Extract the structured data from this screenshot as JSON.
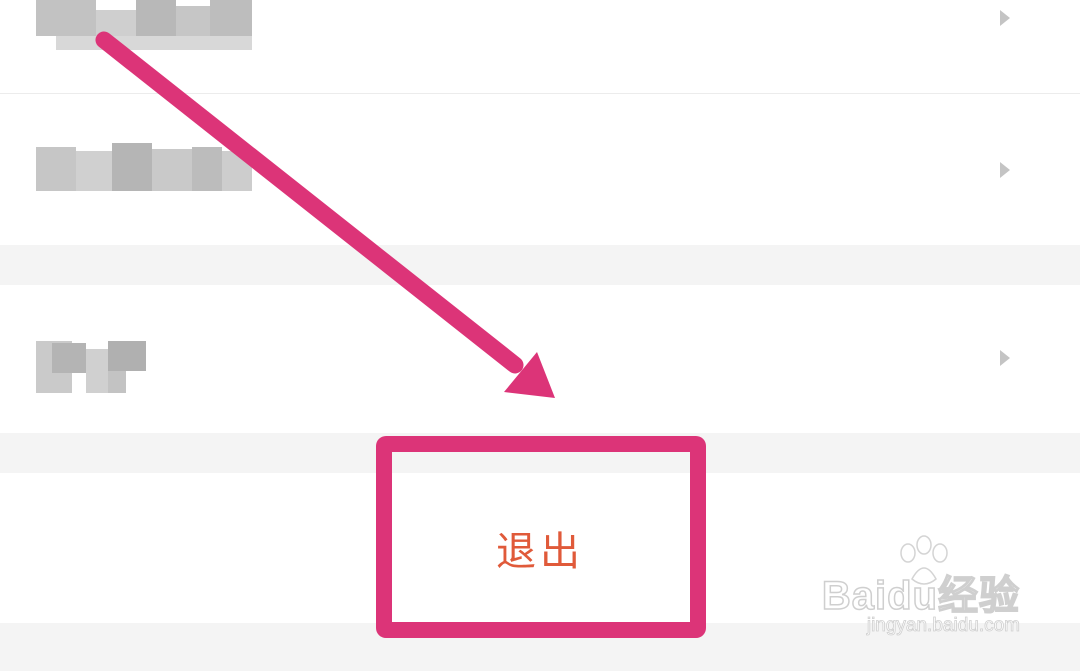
{
  "settings_list": {
    "items": [
      {
        "label": "",
        "redacted": true
      },
      {
        "label": "",
        "redacted": true
      },
      {
        "label": "",
        "redacted": true
      }
    ]
  },
  "logout": {
    "label": "退出"
  },
  "annotation": {
    "color": "#dc3478"
  },
  "watermark": {
    "brand": "Baidu经验",
    "url": "jingyan.baidu.com"
  },
  "colors": {
    "logout_text": "#e05a3a",
    "divider_bg": "#f4f4f4",
    "chevron": "#c4c4c4"
  }
}
